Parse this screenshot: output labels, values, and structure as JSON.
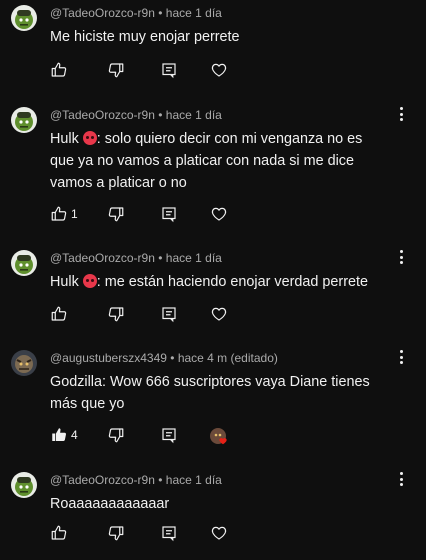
{
  "comments": [
    {
      "author": "@TadeoOrozco-r9n",
      "time": "hace 1 día",
      "text": "Me hiciste muy enojar perrete",
      "likes": "",
      "avatar_icon": "green-character-avatar",
      "show_menu": false,
      "liked": false,
      "creator_heart": false
    },
    {
      "author": "@TadeoOrozco-r9n",
      "time": "hace 1 día",
      "text_before_emoji": "Hulk ",
      "emoji": "angry-face-emoji",
      "text": ": solo quiero decir con mi venganza no es que ya no vamos a platicar con nada si me dice vamos a platicar o no",
      "likes": "1",
      "avatar_icon": "green-character-avatar",
      "show_menu": true,
      "liked": false,
      "creator_heart": false
    },
    {
      "author": "@TadeoOrozco-r9n",
      "time": "hace 1 día",
      "text_before_emoji": "Hulk ",
      "emoji": "angry-face-emoji",
      "text": ": me están haciendo enojar verdad perrete",
      "likes": "",
      "avatar_icon": "green-character-avatar",
      "show_menu": true,
      "liked": false,
      "creator_heart": false
    },
    {
      "author": "@augustuberszx4349",
      "time": "hace 4 m (editado)",
      "text": "Godzilla: Wow 666 suscriptores vaya Diane tienes más que yo",
      "likes": "4",
      "avatar_icon": "monster-avatar",
      "show_menu": true,
      "liked": true,
      "creator_heart": true
    },
    {
      "author": "@TadeoOrozco-r9n",
      "time": "hace 1 día",
      "text": "Roaaaaaaaaaaaar",
      "likes": "",
      "avatar_icon": "green-character-avatar",
      "show_menu": true,
      "liked": false,
      "creator_heart": false
    }
  ],
  "separator": " • ",
  "colors": {
    "background": "#0f0f0f",
    "text": "#f1f1f1",
    "meta": "#aaaaaa",
    "heart": "#e62117"
  }
}
